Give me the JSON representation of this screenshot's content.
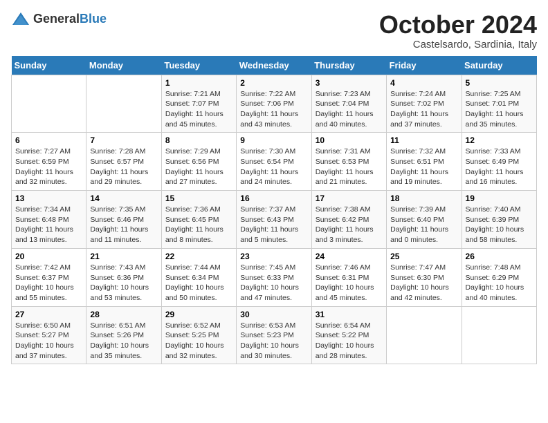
{
  "logo": {
    "general": "General",
    "blue": "Blue"
  },
  "header": {
    "month": "October 2024",
    "location": "Castelsardo, Sardinia, Italy"
  },
  "weekdays": [
    "Sunday",
    "Monday",
    "Tuesday",
    "Wednesday",
    "Thursday",
    "Friday",
    "Saturday"
  ],
  "weeks": [
    [
      {
        "day": "",
        "info": ""
      },
      {
        "day": "",
        "info": ""
      },
      {
        "day": "1",
        "info": "Sunrise: 7:21 AM\nSunset: 7:07 PM\nDaylight: 11 hours and 45 minutes."
      },
      {
        "day": "2",
        "info": "Sunrise: 7:22 AM\nSunset: 7:06 PM\nDaylight: 11 hours and 43 minutes."
      },
      {
        "day": "3",
        "info": "Sunrise: 7:23 AM\nSunset: 7:04 PM\nDaylight: 11 hours and 40 minutes."
      },
      {
        "day": "4",
        "info": "Sunrise: 7:24 AM\nSunset: 7:02 PM\nDaylight: 11 hours and 37 minutes."
      },
      {
        "day": "5",
        "info": "Sunrise: 7:25 AM\nSunset: 7:01 PM\nDaylight: 11 hours and 35 minutes."
      }
    ],
    [
      {
        "day": "6",
        "info": "Sunrise: 7:27 AM\nSunset: 6:59 PM\nDaylight: 11 hours and 32 minutes."
      },
      {
        "day": "7",
        "info": "Sunrise: 7:28 AM\nSunset: 6:57 PM\nDaylight: 11 hours and 29 minutes."
      },
      {
        "day": "8",
        "info": "Sunrise: 7:29 AM\nSunset: 6:56 PM\nDaylight: 11 hours and 27 minutes."
      },
      {
        "day": "9",
        "info": "Sunrise: 7:30 AM\nSunset: 6:54 PM\nDaylight: 11 hours and 24 minutes."
      },
      {
        "day": "10",
        "info": "Sunrise: 7:31 AM\nSunset: 6:53 PM\nDaylight: 11 hours and 21 minutes."
      },
      {
        "day": "11",
        "info": "Sunrise: 7:32 AM\nSunset: 6:51 PM\nDaylight: 11 hours and 19 minutes."
      },
      {
        "day": "12",
        "info": "Sunrise: 7:33 AM\nSunset: 6:49 PM\nDaylight: 11 hours and 16 minutes."
      }
    ],
    [
      {
        "day": "13",
        "info": "Sunrise: 7:34 AM\nSunset: 6:48 PM\nDaylight: 11 hours and 13 minutes."
      },
      {
        "day": "14",
        "info": "Sunrise: 7:35 AM\nSunset: 6:46 PM\nDaylight: 11 hours and 11 minutes."
      },
      {
        "day": "15",
        "info": "Sunrise: 7:36 AM\nSunset: 6:45 PM\nDaylight: 11 hours and 8 minutes."
      },
      {
        "day": "16",
        "info": "Sunrise: 7:37 AM\nSunset: 6:43 PM\nDaylight: 11 hours and 5 minutes."
      },
      {
        "day": "17",
        "info": "Sunrise: 7:38 AM\nSunset: 6:42 PM\nDaylight: 11 hours and 3 minutes."
      },
      {
        "day": "18",
        "info": "Sunrise: 7:39 AM\nSunset: 6:40 PM\nDaylight: 11 hours and 0 minutes."
      },
      {
        "day": "19",
        "info": "Sunrise: 7:40 AM\nSunset: 6:39 PM\nDaylight: 10 hours and 58 minutes."
      }
    ],
    [
      {
        "day": "20",
        "info": "Sunrise: 7:42 AM\nSunset: 6:37 PM\nDaylight: 10 hours and 55 minutes."
      },
      {
        "day": "21",
        "info": "Sunrise: 7:43 AM\nSunset: 6:36 PM\nDaylight: 10 hours and 53 minutes."
      },
      {
        "day": "22",
        "info": "Sunrise: 7:44 AM\nSunset: 6:34 PM\nDaylight: 10 hours and 50 minutes."
      },
      {
        "day": "23",
        "info": "Sunrise: 7:45 AM\nSunset: 6:33 PM\nDaylight: 10 hours and 47 minutes."
      },
      {
        "day": "24",
        "info": "Sunrise: 7:46 AM\nSunset: 6:31 PM\nDaylight: 10 hours and 45 minutes."
      },
      {
        "day": "25",
        "info": "Sunrise: 7:47 AM\nSunset: 6:30 PM\nDaylight: 10 hours and 42 minutes."
      },
      {
        "day": "26",
        "info": "Sunrise: 7:48 AM\nSunset: 6:29 PM\nDaylight: 10 hours and 40 minutes."
      }
    ],
    [
      {
        "day": "27",
        "info": "Sunrise: 6:50 AM\nSunset: 5:27 PM\nDaylight: 10 hours and 37 minutes."
      },
      {
        "day": "28",
        "info": "Sunrise: 6:51 AM\nSunset: 5:26 PM\nDaylight: 10 hours and 35 minutes."
      },
      {
        "day": "29",
        "info": "Sunrise: 6:52 AM\nSunset: 5:25 PM\nDaylight: 10 hours and 32 minutes."
      },
      {
        "day": "30",
        "info": "Sunrise: 6:53 AM\nSunset: 5:23 PM\nDaylight: 10 hours and 30 minutes."
      },
      {
        "day": "31",
        "info": "Sunrise: 6:54 AM\nSunset: 5:22 PM\nDaylight: 10 hours and 28 minutes."
      },
      {
        "day": "",
        "info": ""
      },
      {
        "day": "",
        "info": ""
      }
    ]
  ]
}
